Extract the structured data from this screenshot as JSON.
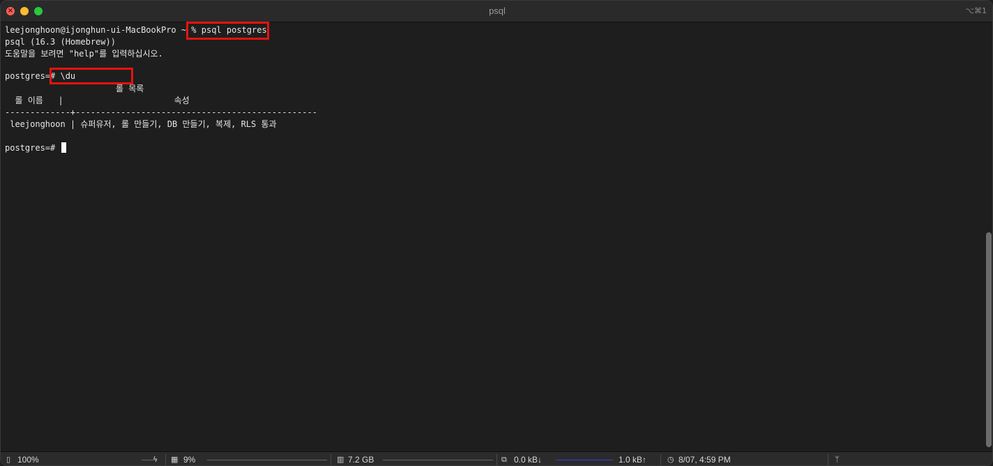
{
  "window": {
    "title": "psql",
    "shortcut": "⌥⌘1"
  },
  "terminal": {
    "lines": [
      "leejonghoon@ijonghun-ui-MacBookPro ~ % psql postgres",
      "psql (16.3 (Homebrew))",
      "도움말을 보려면 \"help\"를 입력하십시오.",
      "",
      "postgres=# \\du",
      "                      롤 목록",
      "  롤 이름   |                      속성",
      "-------------+------------------------------------------------",
      " leejonghoon | 슈퍼유저, 롤 만들기, DB 만들기, 복제, RLS 통과",
      "",
      "postgres=# "
    ]
  },
  "statusbar": {
    "battery": "100%",
    "cpu": "9%",
    "memory": "7.2 GB",
    "net_down": "0.0 kB↓",
    "net_up": "1.0 kB↑",
    "clock": "8/07, 4:59 PM"
  },
  "colors": {
    "highlight": "#e8130f",
    "background": "#1e1e1e"
  }
}
